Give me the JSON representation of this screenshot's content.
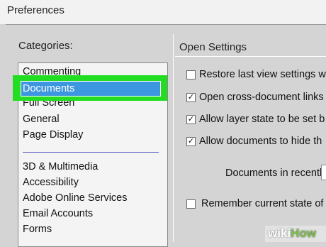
{
  "window": {
    "title": "Preferences"
  },
  "categories": {
    "label": "Categories:",
    "selected": "Documents",
    "group1": [
      "Commenting",
      "Documents",
      "Full Screen",
      "General",
      "Page Display"
    ],
    "group2": [
      "3D & Multimedia",
      "Accessibility",
      "Adobe Online Services",
      "Email Accounts",
      "Forms"
    ]
  },
  "open_settings": {
    "title": "Open Settings",
    "options": [
      {
        "label": "Restore last view settings wi",
        "checked": false
      },
      {
        "label": "Open cross-document links",
        "checked": true
      },
      {
        "label": "Allow layer state to be set b",
        "checked": true
      },
      {
        "label": "Allow documents to hide th",
        "checked": true
      }
    ],
    "documents_recently": "Documents in recently",
    "remember_label": "Remember current state of",
    "remember_checked": false
  },
  "watermark": {
    "wiki": "wiki",
    "how": "How"
  },
  "colors": {
    "selection": "#3d97e0",
    "highlight_border": "#22dd22"
  }
}
